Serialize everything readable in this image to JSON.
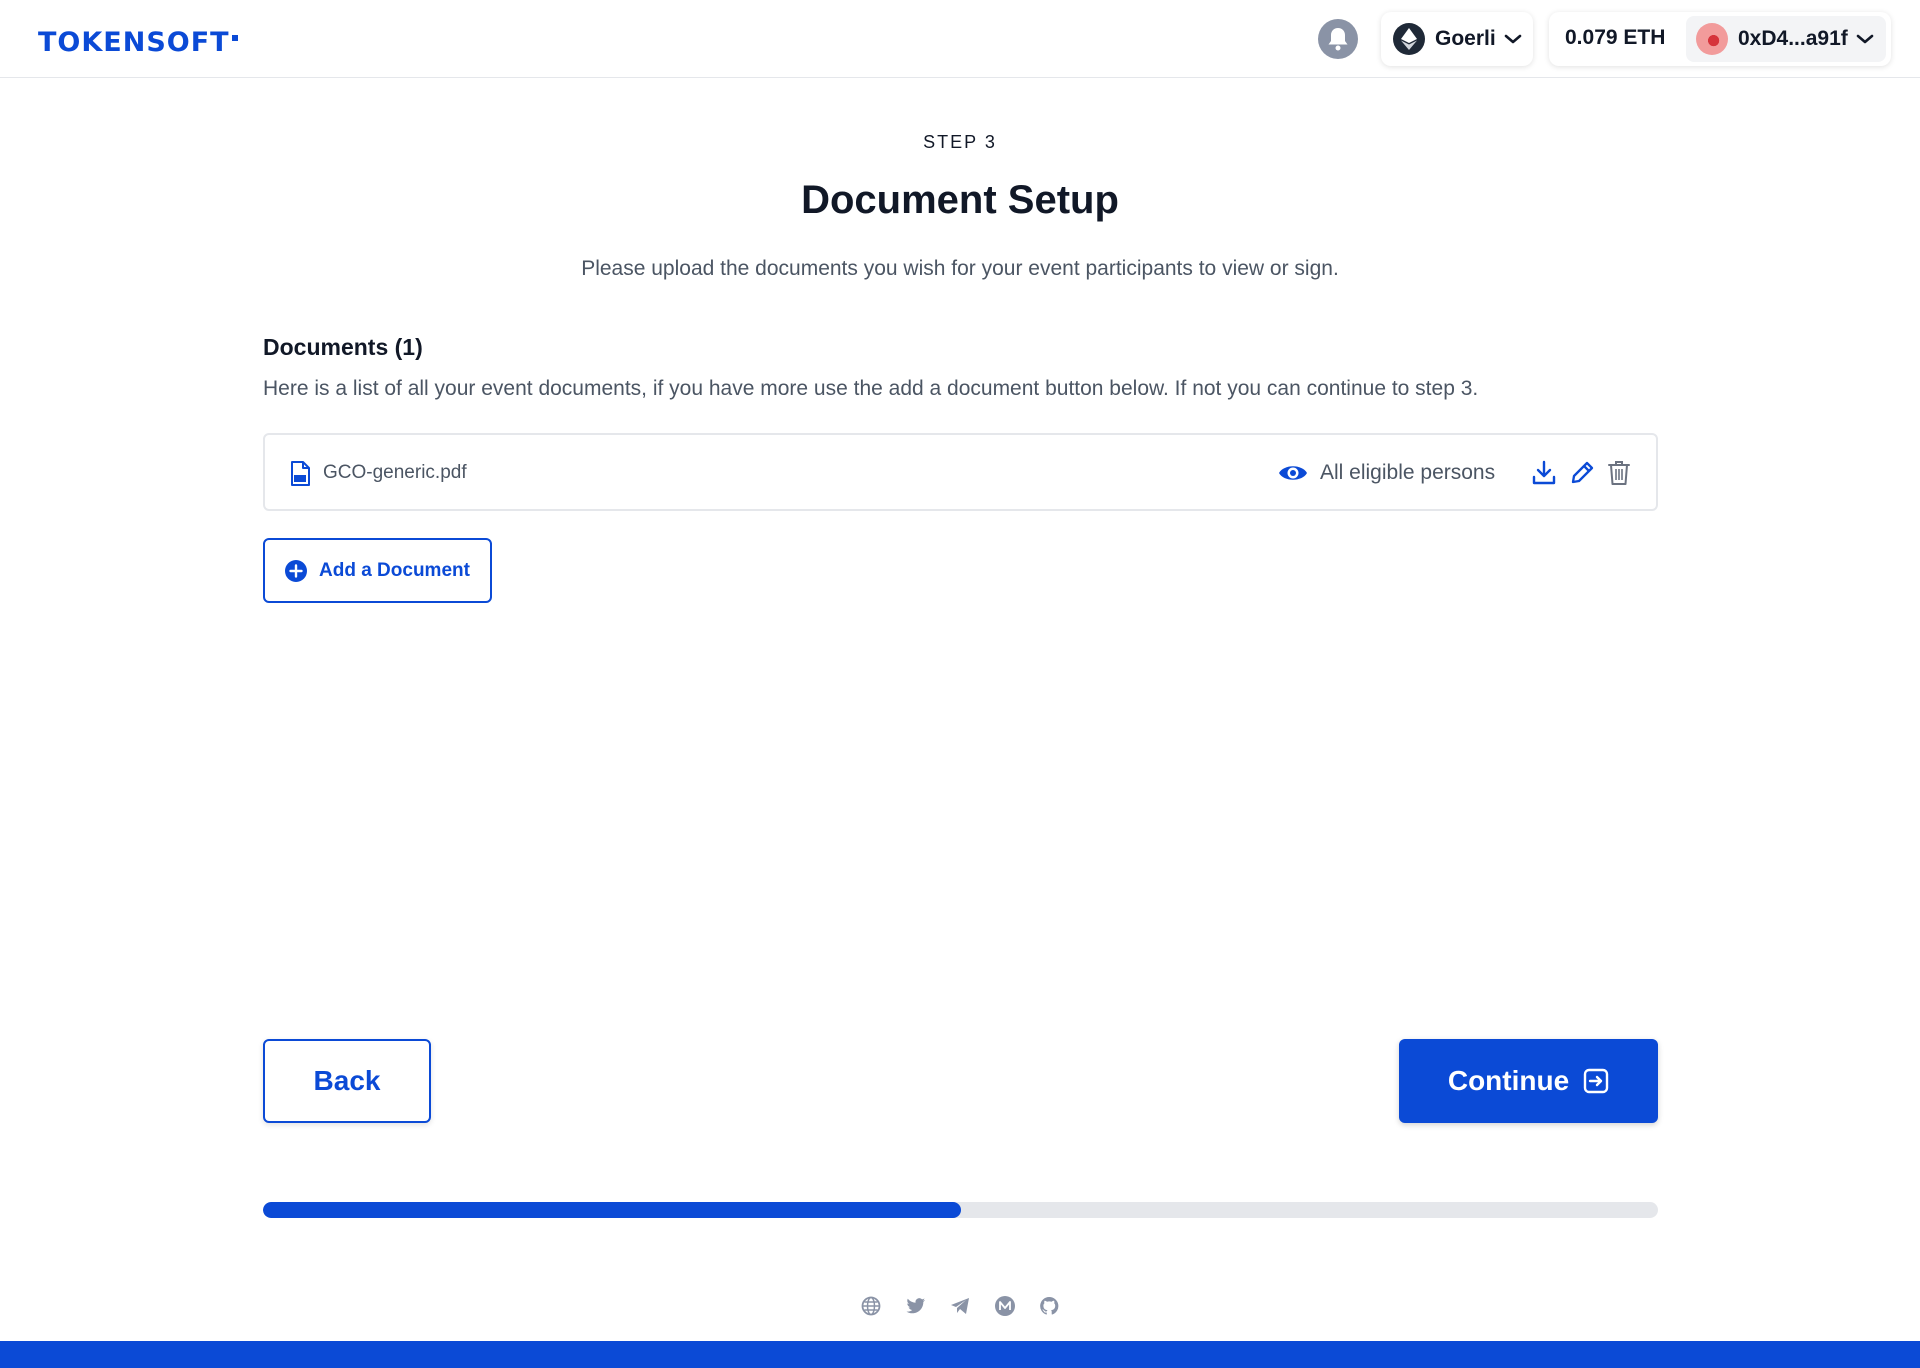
{
  "header": {
    "logo_text": "TOKENSOFT",
    "network": "Goerli",
    "balance": "0.079 ETH",
    "wallet_address": "0xD4...a91f"
  },
  "step": {
    "label": "STEP 3",
    "title": "Document Setup",
    "subtitle": "Please upload the documents you wish for your event participants to view or sign."
  },
  "documents": {
    "heading": "Documents (1)",
    "description": "Here is a list of all your event documents, if you have more use the add a document button below. If not you can continue to step 3.",
    "items": [
      {
        "name": "GCO-generic.pdf",
        "visibility": "All eligible persons"
      }
    ],
    "add_label": "Add a Document"
  },
  "actions": {
    "back_label": "Back",
    "continue_label": "Continue"
  },
  "progress": {
    "fraction": 0.5
  },
  "colors": {
    "accent": "#0b4ad6",
    "muted_icon": "#8a93a6"
  },
  "icons": {
    "header": [
      "bell-icon",
      "ethereum-icon",
      "chevron-down-icon"
    ],
    "document_row": [
      "pdf-file-icon",
      "eye-icon",
      "download-icon",
      "edit-icon",
      "trash-icon"
    ],
    "socials": [
      "globe-icon",
      "twitter-icon",
      "telegram-icon",
      "medium-icon",
      "github-icon"
    ]
  }
}
